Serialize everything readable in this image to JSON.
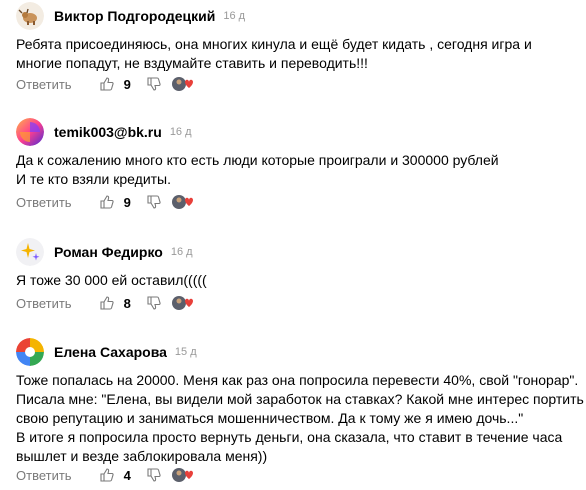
{
  "comments": [
    {
      "author": "Виктор Подгородецкий",
      "date": "16 д",
      "lines": [
        "Ребята присоединяюсь, она многих кинула и ещё будет кидать , сегодня игра и",
        "многие попадут, не вздумайте ставить и переводить!!!"
      ],
      "likes": "9",
      "reply_label": "Ответить",
      "avatar_icon": "bull-avatar-icon"
    },
    {
      "author": "temik003@bk.ru",
      "date": "16 д",
      "lines": [
        "Да к сожалению много кто есть люди которые проиграли и 300000 рублей",
        "И те кто взяли кредиты."
      ],
      "likes": "9",
      "reply_label": "Ответить",
      "avatar_icon": "gradient-swirl-avatar-icon"
    },
    {
      "author": "Роман Федирко",
      "date": "16 д",
      "lines": [
        "Я тоже 30 000 ей оставил((((("
      ],
      "likes": "8",
      "reply_label": "Ответить",
      "avatar_icon": "sparkle-avatar-icon"
    },
    {
      "author": "Елена Сахарова",
      "date": "15 д",
      "lines": [
        "Тоже попалась на 20000. Меня как раз она попросила перевести 40%, свой \"гонорар\".",
        "Писала мне: \"Елена, вы видели мой заработок на ставках? Какой мне интерес портить",
        "свою репутацию и заниматься мошенничеством. Да к тому же я имею дочь...\"",
        "В итоге я попросила просто вернуть деньги, она сказала, что ставит в течение часа",
        "вышлет и везде заблокировала меня))"
      ],
      "likes": "4",
      "reply_label": "Ответить",
      "avatar_icon": "pinwheel-avatar-icon"
    }
  ],
  "colors": {
    "muted": "#7a7a7a",
    "date": "#999999",
    "heart": "#e8403a"
  }
}
